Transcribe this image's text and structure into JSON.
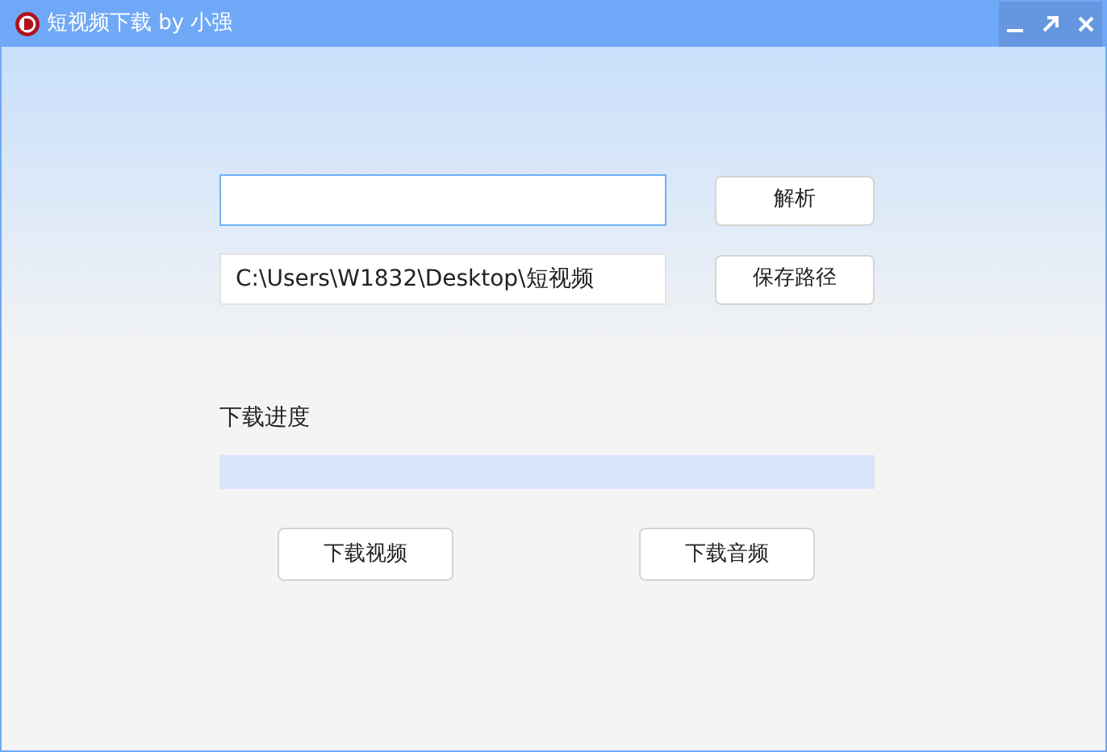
{
  "window": {
    "title": "短视频下载 by 小强"
  },
  "parse_button": "解析",
  "path_field": {
    "value": "C:\\Users\\W1832\\Desktop\\短视频"
  },
  "save_path_button": "保存路径",
  "progress": {
    "label": "下载进度",
    "level": 0
  },
  "buttons": [
    "下载视频",
    "下载音频"
  ]
}
